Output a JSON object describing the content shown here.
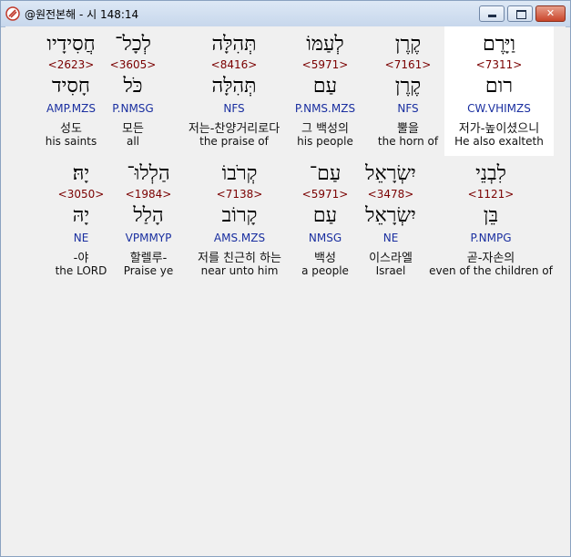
{
  "window": {
    "title": "@원전본해 - 시 148:14",
    "controls": {
      "minimize": "minimize",
      "maximize": "maximize",
      "close": "✕"
    }
  },
  "rows": [
    [
      {
        "hebrew": "וַיָּרֶם",
        "strong": "<7311>",
        "lexeme": "רום",
        "morph": "CW.VHIMZS",
        "korean": "저가-높이셨으니",
        "english": "He also exalteth",
        "highlight": true
      },
      {
        "hebrew": "קֶרֶן",
        "strong": "<7161>",
        "lexeme": "קֶרֶן",
        "morph": "NFS",
        "korean": "뿔을",
        "english": "the horn of"
      },
      {
        "hebrew": "לְעַמּוֹ",
        "strong": "<5971>",
        "lexeme": "עַם",
        "morph": "P.NMS.MZS",
        "korean": "그 백성의",
        "english": "his people"
      },
      {
        "hebrew": "תְּהִלָּה",
        "strong": "<8416>",
        "lexeme": "תְּהִלָּה",
        "morph": "NFS",
        "korean": "저는-찬양거리로다",
        "english": "the praise of"
      },
      {
        "hebrew": "לְכָל־",
        "strong": "<3605>",
        "lexeme": "כֹּל",
        "morph": "P.NMSG",
        "korean": "모든",
        "english": "all"
      },
      {
        "hebrew": "חֲסִידָיו",
        "strong": "<2623>",
        "lexeme": "חָסִיד",
        "morph": "AMP.MZS",
        "korean": "성도",
        "english": "his saints"
      }
    ],
    [
      {
        "hebrew": "לִבְנֵי",
        "strong": "<1121>",
        "lexeme": "בֵּן",
        "morph": "P.NMPG",
        "korean": "곧-자손의",
        "english": "even of the children of"
      },
      {
        "hebrew": "יִשְׂרָאֵל",
        "strong": "<3478>",
        "lexeme": "יִשְׂרָאֵל",
        "morph": "NE",
        "korean": "이스라엘",
        "english": "Israel"
      },
      {
        "hebrew": "עַם־",
        "strong": "<5971>",
        "lexeme": "עַם",
        "morph": "NMSG",
        "korean": "백성",
        "english": "a people"
      },
      {
        "hebrew": "קְרֹבוֹ",
        "strong": "<7138>",
        "lexeme": "קָרוֹב",
        "morph": "AMS.MZS",
        "korean": "저를 친근히 하는",
        "english": "near unto him"
      },
      {
        "hebrew": "הַלְלוּ־",
        "strong": "<1984>",
        "lexeme": "הָלַל",
        "morph": "VPMMYP",
        "korean": "할렐루-",
        "english": "Praise ye"
      },
      {
        "hebrew": "יָהּ׃",
        "strong": "<3050>",
        "lexeme": "יָהּ",
        "morph": "NE",
        "korean": "-야",
        "english": "the LORD"
      }
    ]
  ]
}
